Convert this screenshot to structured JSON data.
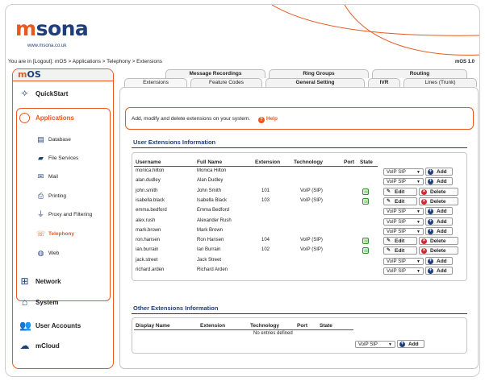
{
  "brand": {
    "logo_m": "m",
    "logo_rest": "sona",
    "url": "www.msona.co.uk",
    "version": "mOS 1.0",
    "accent": "#e8581f",
    "navy": "#1f3f7a"
  },
  "breadcrumb": "You are in [Logout]: mOS > Applications > Telephony > Extensions",
  "sidebar": {
    "title_m": "m",
    "title_rest": "OS",
    "items": [
      {
        "label": "QuickStart",
        "icon": "wand-icon"
      },
      {
        "label": "Applications",
        "icon": "apps-icon"
      },
      {
        "label": "Database",
        "icon": "database-icon"
      },
      {
        "label": "File Services",
        "icon": "folder-icon"
      },
      {
        "label": "Mail",
        "icon": "mail-icon"
      },
      {
        "label": "Printing",
        "icon": "printer-icon"
      },
      {
        "label": "Proxy and Filtering",
        "icon": "filter-icon"
      },
      {
        "label": "Telephony",
        "icon": "phone-icon"
      },
      {
        "label": "Web",
        "icon": "globe-icon"
      },
      {
        "label": "Network",
        "icon": "network-icon"
      },
      {
        "label": "System",
        "icon": "home-icon"
      },
      {
        "label": "User Accounts",
        "icon": "users-icon"
      },
      {
        "label": "mCloud",
        "icon": "cloud-icon"
      }
    ]
  },
  "tabs_top": [
    "Message Recordings",
    "Ring Groups",
    "Routing"
  ],
  "tabs_bottom": [
    "Extensions",
    "Feature Codes",
    "General Setting",
    "IVR",
    "Lines (Trunk)"
  ],
  "info": {
    "text": "Add, modify and delete extensions on your system.",
    "help": "Help"
  },
  "user_ext": {
    "title": "User Extensions Information",
    "headers": [
      "Username",
      "Full Name",
      "Extension",
      "Technology",
      "Port",
      "State"
    ],
    "rows": [
      {
        "username": "monica.hilton",
        "fullname": "Monica Hilton",
        "ext": "",
        "tech": "",
        "configured": false
      },
      {
        "username": "alan.dudley",
        "fullname": "Alan Dudley",
        "ext": "",
        "tech": "",
        "configured": false
      },
      {
        "username": "john.smith",
        "fullname": "John Smith",
        "ext": "101",
        "tech": "VoIP (SIP)",
        "configured": true
      },
      {
        "username": "isabella.black",
        "fullname": "Isabella Black",
        "ext": "103",
        "tech": "VoIP (SIP)",
        "configured": true
      },
      {
        "username": "emma.bedford",
        "fullname": "Emma Bedford",
        "ext": "",
        "tech": "",
        "configured": false
      },
      {
        "username": "alex.rush",
        "fullname": "Alexander Rush",
        "ext": "",
        "tech": "",
        "configured": false
      },
      {
        "username": "mark.brown",
        "fullname": "Mark Brown",
        "ext": "",
        "tech": "",
        "configured": false
      },
      {
        "username": "ron.hansen",
        "fullname": "Ron Hansen",
        "ext": "104",
        "tech": "VoIP (SIP)",
        "configured": true
      },
      {
        "username": "ian.burrain",
        "fullname": "Ian Burrain",
        "ext": "102",
        "tech": "VoIP (SIP)",
        "configured": true
      },
      {
        "username": "jack.street",
        "fullname": "Jack Street",
        "ext": "",
        "tech": "",
        "configured": false
      },
      {
        "username": "richard.arden",
        "fullname": "Richard Arden",
        "ext": "",
        "tech": "",
        "configured": false
      }
    ],
    "select_value": "VoIP SIP",
    "add_label": "Add",
    "edit_label": "Edit",
    "delete_label": "Delete"
  },
  "other_ext": {
    "title": "Other Extensions Information",
    "headers": [
      "Display Name",
      "Extension",
      "Technology",
      "Port",
      "State"
    ],
    "empty": "No entries defined",
    "select_value": "VoIP SIP",
    "add_label": "Add"
  }
}
